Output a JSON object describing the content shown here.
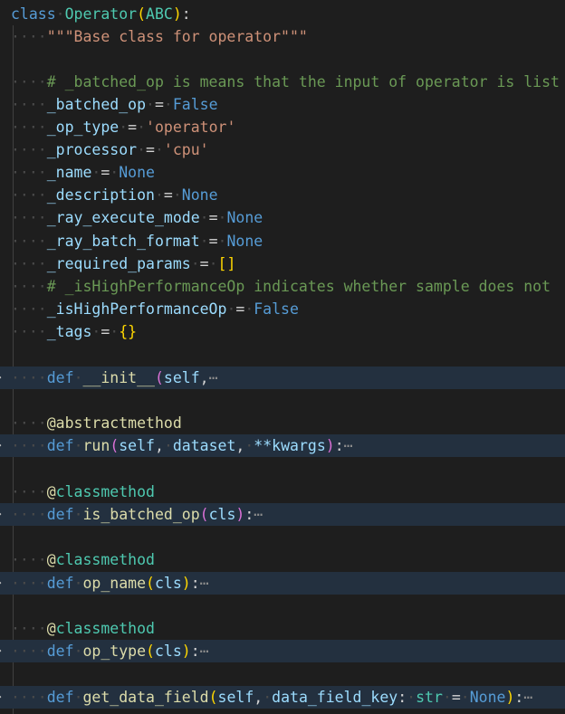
{
  "code": {
    "class_keyword": "class",
    "class_name": "Operator",
    "base_class": "ABC",
    "docstring": "\"\"\"Base class for operator\"\"\"",
    "comment_batched": "# _batched_op is means that the input of operator is list",
    "batched_op": {
      "name": "_batched_op",
      "value": "False"
    },
    "op_type": {
      "name": "_op_type",
      "value": "'operator'"
    },
    "processor": {
      "name": "_processor",
      "value": "'cpu'"
    },
    "name_attr": {
      "name": "_name",
      "value": "None"
    },
    "description": {
      "name": "_description",
      "value": "None"
    },
    "ray_execute_mode": {
      "name": "_ray_execute_mode",
      "value": "None"
    },
    "ray_batch_format": {
      "name": "_ray_batch_format",
      "value": "None"
    },
    "required_params": {
      "name": "_required_params",
      "value": "[]"
    },
    "comment_high_perf": "# _isHighPerformanceOp indicates whether sample does not",
    "is_high_perf": {
      "name": "_isHighPerformanceOp",
      "value": "False"
    },
    "tags": {
      "name": "_tags",
      "value": "{}"
    },
    "def_keyword": "def",
    "init_fn": "__init__",
    "self_param": "self",
    "cls_param": "cls",
    "abstract_decorator": "@abstractmethod",
    "classmethod_decorator": "@classmethod",
    "run_fn": "run",
    "dataset_param": "dataset",
    "kwargs_param": "**kwargs",
    "is_batched_op_fn": "is_batched_op",
    "op_name_fn": "op_name",
    "op_type_fn": "op_type",
    "get_data_field_fn": "get_data_field",
    "data_field_key_param": "data_field_key",
    "str_type": "str",
    "none_default": "None",
    "ellipsis": "⋯",
    "fold_arrow": "›",
    "indent_dots": "····"
  }
}
